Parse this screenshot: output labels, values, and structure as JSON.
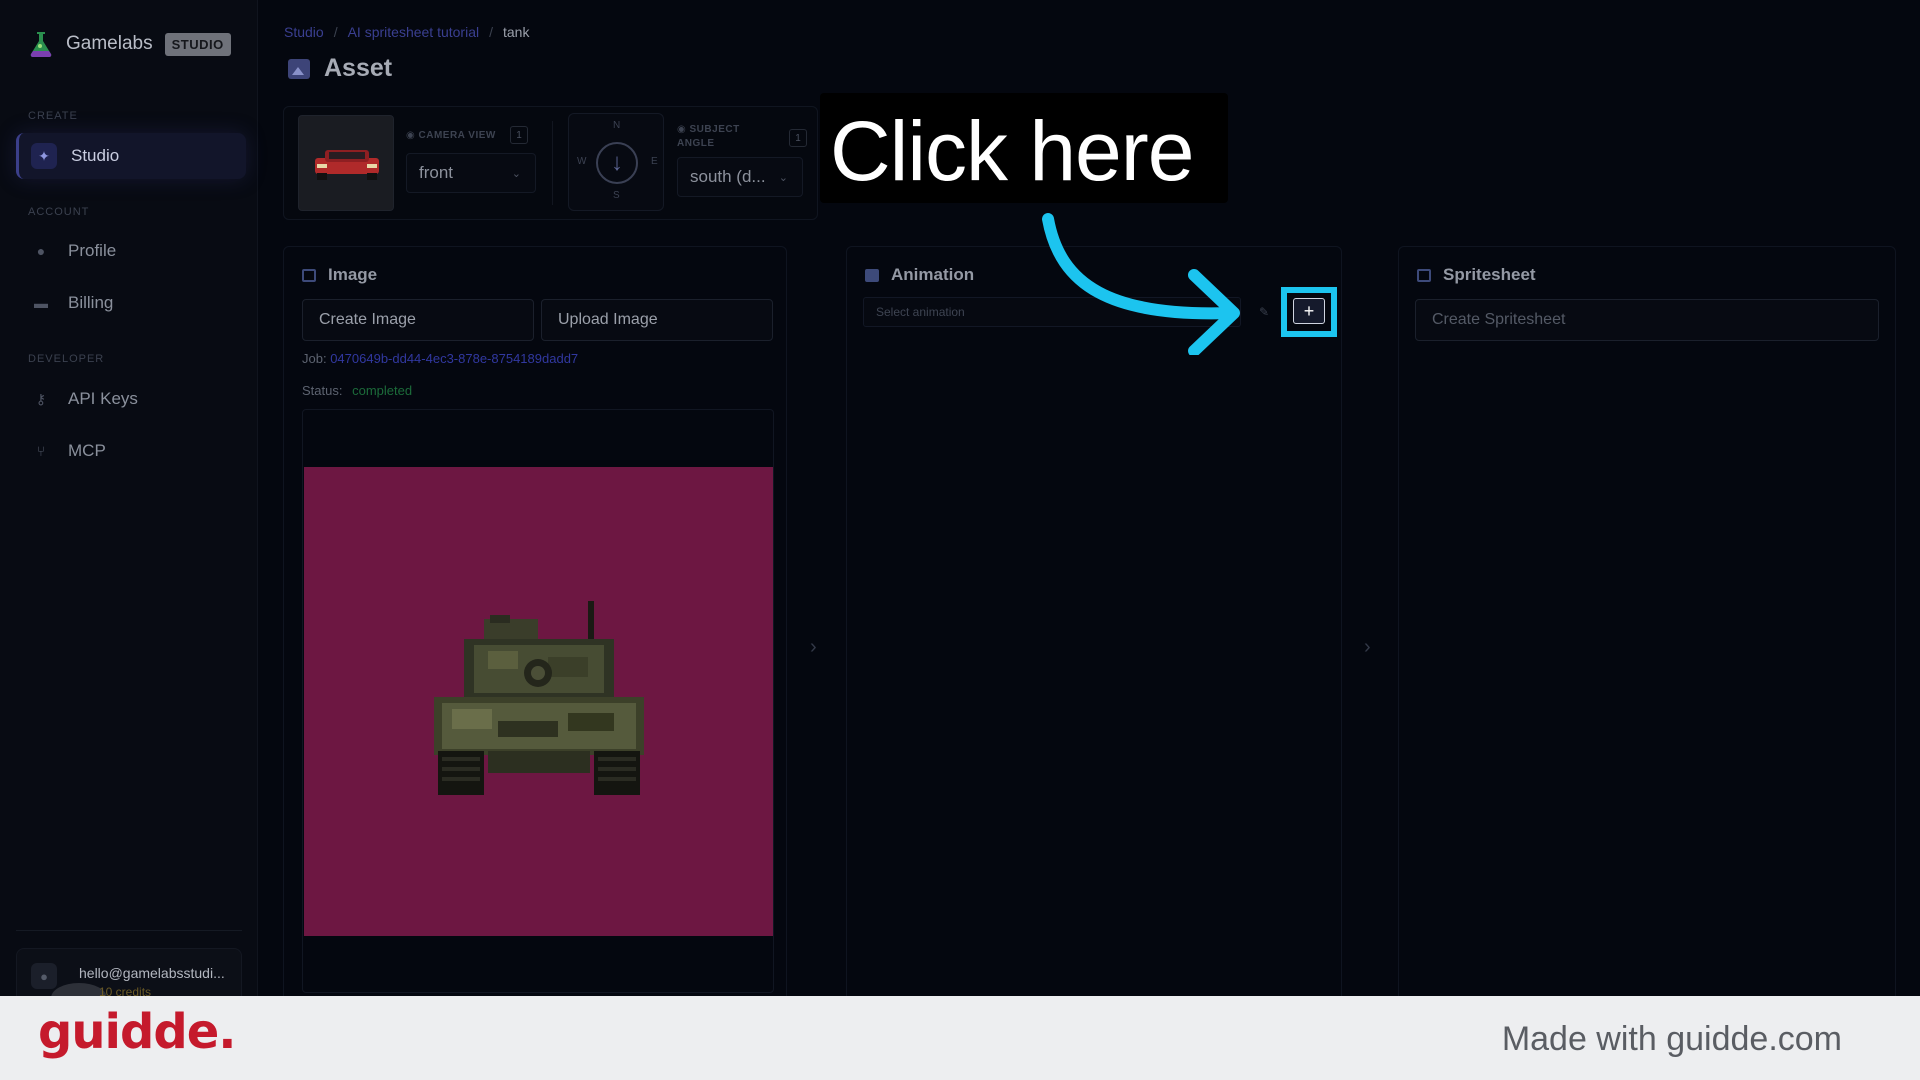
{
  "brand": {
    "name": "Gamelabs",
    "badge": "STUDIO"
  },
  "sidebar": {
    "sections": [
      {
        "label": "CREATE"
      },
      {
        "label": "ACCOUNT"
      },
      {
        "label": "DEVELOPER"
      }
    ],
    "items": [
      {
        "label": "Studio",
        "icon": "magic-wand-icon",
        "active": true
      },
      {
        "label": "Profile",
        "icon": "user-icon"
      },
      {
        "label": "Billing",
        "icon": "credit-card-icon"
      },
      {
        "label": "API Keys",
        "icon": "key-icon"
      },
      {
        "label": "MCP",
        "icon": "branch-icon"
      }
    ],
    "user": {
      "email": "hello@gamelabsstudi...",
      "credits": "10 credits"
    }
  },
  "breadcrumb": {
    "items": [
      "Studio",
      "AI spritesheet tutorial"
    ],
    "current": "tank",
    "separator": "/"
  },
  "page": {
    "title": "Asset"
  },
  "config": {
    "camera_view_label": "CAMERA VIEW",
    "camera_view_count": "1",
    "camera_view_value": "front",
    "compass": {
      "n": "N",
      "s": "S",
      "e": "E",
      "w": "W"
    },
    "subject_angle_label_1": "SUBJECT",
    "subject_angle_label_2": "ANGLE",
    "subject_angle_count": "1",
    "subject_angle_value": "south (d..."
  },
  "image_panel": {
    "title": "Image",
    "create_label": "Create Image",
    "upload_label": "Upload Image",
    "job_prefix": "Job:",
    "job_id": "0470649b-dd44-4ec3-878e-8754189dadd7",
    "status_prefix": "Status:",
    "status_value": "completed",
    "background_color": "#6d1742"
  },
  "animation_panel": {
    "title": "Animation",
    "select_placeholder": "Select animation",
    "add_label": "+"
  },
  "spritesheet_panel": {
    "title": "Spritesheet",
    "create_label": "Create Spritesheet"
  },
  "callout": {
    "text": "Click here",
    "color": "#1cc4ef"
  },
  "footer": {
    "logo": "guidde.",
    "made_with": "Made with guidde.com"
  }
}
